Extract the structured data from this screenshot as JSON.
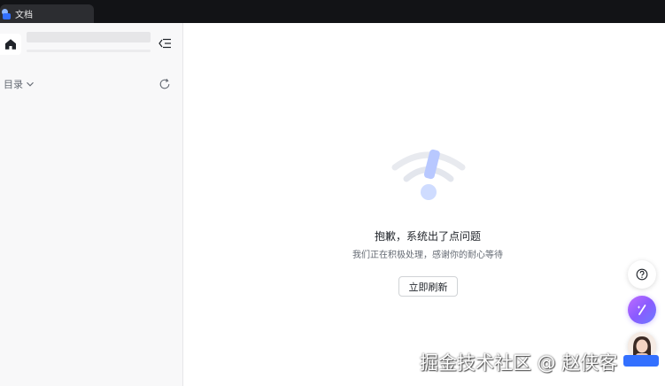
{
  "tab": {
    "label": "文档",
    "icon": "doc-app-icon"
  },
  "sidebar": {
    "home_icon": "home-icon",
    "collapse_icon": "collapse-sidebar-icon",
    "toc_label": "目录",
    "toc_icon": "chevron-down-icon",
    "refresh_icon": "refresh-icon"
  },
  "error": {
    "illustration": "wifi-error-illustration",
    "title": "抱歉，系统出了点问题",
    "description": "我们正在积极处理，感谢你的耐心等待",
    "button_label": "立即刷新"
  },
  "fabs": {
    "help_icon": "help-icon",
    "ai_icon": "ai-assistant-icon",
    "avatar": "user-avatar"
  },
  "watermark": "掘金技术社区 @ 赵侠客",
  "colors": {
    "tabbar_bg": "#121316",
    "sidebar_bg": "#f8f8f9",
    "accent": "#3370ff"
  }
}
